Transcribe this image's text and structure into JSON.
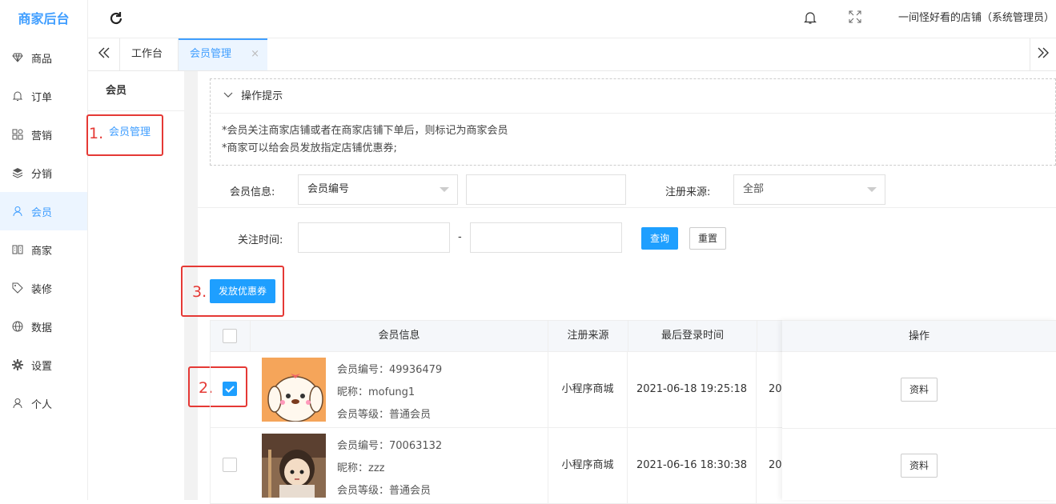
{
  "app_title": "商家后台",
  "sidebar": {
    "items": [
      {
        "label": "商品",
        "icon": "diamond-icon"
      },
      {
        "label": "订单",
        "icon": "bell-icon"
      },
      {
        "label": "营销",
        "icon": "apps-icon"
      },
      {
        "label": "分销",
        "icon": "layers-icon"
      },
      {
        "label": "会员",
        "icon": "user-icon",
        "active": true
      },
      {
        "label": "商家",
        "icon": "store-icon"
      },
      {
        "label": "装修",
        "icon": "tag-icon"
      },
      {
        "label": "数据",
        "icon": "globe-icon"
      },
      {
        "label": "设置",
        "icon": "gear-icon"
      },
      {
        "label": "个人",
        "icon": "person-icon"
      }
    ]
  },
  "header": {
    "shop_name": "一间怪好看的店铺（系统管理员）"
  },
  "tabs": {
    "items": [
      {
        "label": "工作台"
      },
      {
        "label": "会员管理",
        "active": true,
        "close": "×"
      }
    ]
  },
  "subnav": {
    "title": "会员",
    "items": [
      {
        "label": "会员管理"
      }
    ]
  },
  "tips": {
    "title": "操作提示",
    "lines": [
      "*会员关注商家店铺或者在商家店铺下单后，则标记为商家会员",
      "*商家可以给会员发放指定店铺优惠券;"
    ]
  },
  "filters": {
    "member_info_label": "会员信息:",
    "member_info_select": "会员编号",
    "member_info_value": "",
    "register_source_label": "注册来源:",
    "register_source_select": "全部",
    "follow_time_label": "关注时间:",
    "date_sep": "-",
    "query_label": "查询",
    "reset_label": "重置"
  },
  "actions": {
    "issue_coupon_label": "发放优惠券"
  },
  "annotations": {
    "step1": "1.",
    "step2": "2.",
    "step3": "3."
  },
  "table": {
    "columns": [
      "会员信息",
      "注册来源",
      "最后登录时间",
      "操作"
    ],
    "rows": [
      {
        "checked": true,
        "member_no": "会员编号：49936479",
        "nickname": "昵称：mofung1",
        "level": "会员等级：普通会员",
        "source": "小程序商城",
        "last_login": "2021-06-18 19:25:18",
        "truncated": "20",
        "detail_label": "资料"
      },
      {
        "checked": false,
        "member_no": "会员编号：70063132",
        "nickname": "昵称：zzz",
        "level": "会员等级：普通会员",
        "source": "小程序商城",
        "last_login": "2021-06-16 18:30:38",
        "truncated": "20",
        "detail_label": "资料"
      }
    ]
  },
  "colors": {
    "accent": "#409eff",
    "primary_button": "#1e9fff",
    "annotation_red": "#e53935"
  }
}
